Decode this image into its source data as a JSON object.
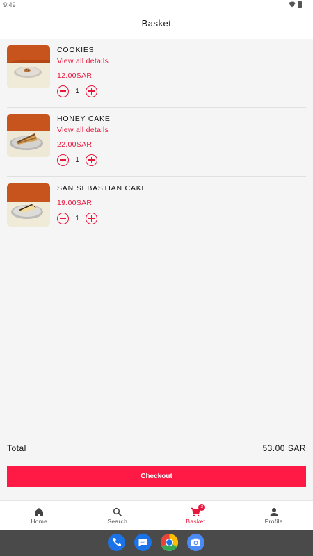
{
  "status_bar": {
    "time": "9:49"
  },
  "header": {
    "title": "Basket"
  },
  "cart": {
    "items": [
      {
        "name": "COOKIES",
        "details_link": "View all details",
        "price": "12.00SAR",
        "quantity": "1"
      },
      {
        "name": "HONEY CAKE",
        "details_link": "View all details",
        "price": "22.00SAR",
        "quantity": "1"
      },
      {
        "name": "SAN SEBASTIAN CAKE",
        "price": "19.00SAR",
        "quantity": "1"
      }
    ]
  },
  "summary": {
    "total_label": "Total",
    "total_value": "53.00 SAR"
  },
  "checkout": {
    "label": "Checkout"
  },
  "bottom_nav": {
    "items": [
      {
        "label": "Home",
        "icon": "home-icon"
      },
      {
        "label": "Search",
        "icon": "search-icon"
      },
      {
        "label": "Basket",
        "icon": "cart-icon",
        "badge": "3",
        "active": true
      },
      {
        "label": "Profile",
        "icon": "person-icon"
      }
    ]
  },
  "system_dock": {
    "apps": [
      "phone-icon",
      "messages-icon",
      "chrome-icon",
      "camera-icon"
    ]
  },
  "colors": {
    "accent": "#e8163c",
    "checkout_bg": "#fe1a44",
    "background": "#f5f5f5"
  }
}
